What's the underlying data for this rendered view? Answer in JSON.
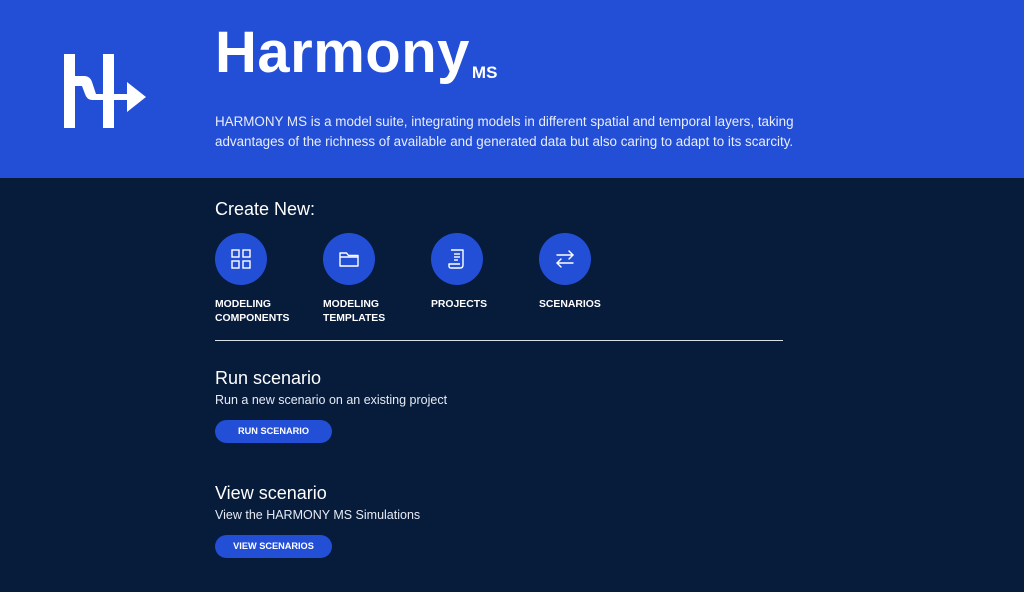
{
  "hero": {
    "brand_name": "Harmony",
    "brand_suffix": "MS",
    "description": "HARMONY MS is a model suite, integrating models in different spatial and temporal layers, taking advantages of the richness of available and generated data but also caring to adapt to its scarcity."
  },
  "create_new": {
    "title": "Create New:",
    "items": [
      {
        "icon": "grid-icon",
        "label_line1": "MODELING",
        "label_line2": "COMPONENTS"
      },
      {
        "icon": "folder-icon",
        "label_line1": "MODELING",
        "label_line2": "TEMPLATES"
      },
      {
        "icon": "document-icon",
        "label_line1": "PROJECTS",
        "label_line2": ""
      },
      {
        "icon": "swap-arrows-icon",
        "label_line1": "SCENARIOS",
        "label_line2": ""
      }
    ]
  },
  "run_scenario": {
    "title": "Run scenario",
    "description": "Run a new scenario on an existing project",
    "button_label": "RUN SCENARIO"
  },
  "view_scenario": {
    "title": "View scenario",
    "description": "View the HARMONY MS Simulations",
    "button_label": "VIEW SCENARIOS"
  },
  "colors": {
    "hero_blue": "#234ed6",
    "page_navy": "#071b3b",
    "text_white": "#ffffff"
  }
}
